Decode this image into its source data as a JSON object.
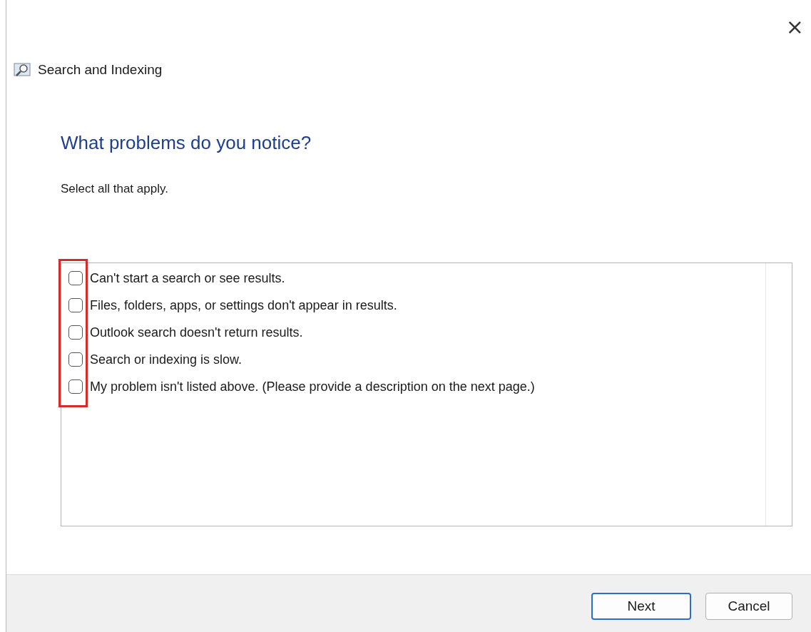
{
  "window": {
    "title": "Search and Indexing",
    "close": "×"
  },
  "heading": "What problems do you notice?",
  "instruction": "Select all that apply.",
  "options": [
    {
      "label": "Can't start a search or see results.",
      "checked": false
    },
    {
      "label": "Files, folders, apps, or settings don't appear in results.",
      "checked": false
    },
    {
      "label": "Outlook search doesn't return results.",
      "checked": false
    },
    {
      "label": "Search or indexing is slow.",
      "checked": false
    },
    {
      "label": "My problem isn't listed above. (Please provide a description on the next page.)",
      "checked": false
    }
  ],
  "annotation": {
    "color": "#d62b2b"
  },
  "buttons": [
    {
      "label": "Next",
      "default": true
    },
    {
      "label": "Cancel",
      "default": false
    }
  ]
}
